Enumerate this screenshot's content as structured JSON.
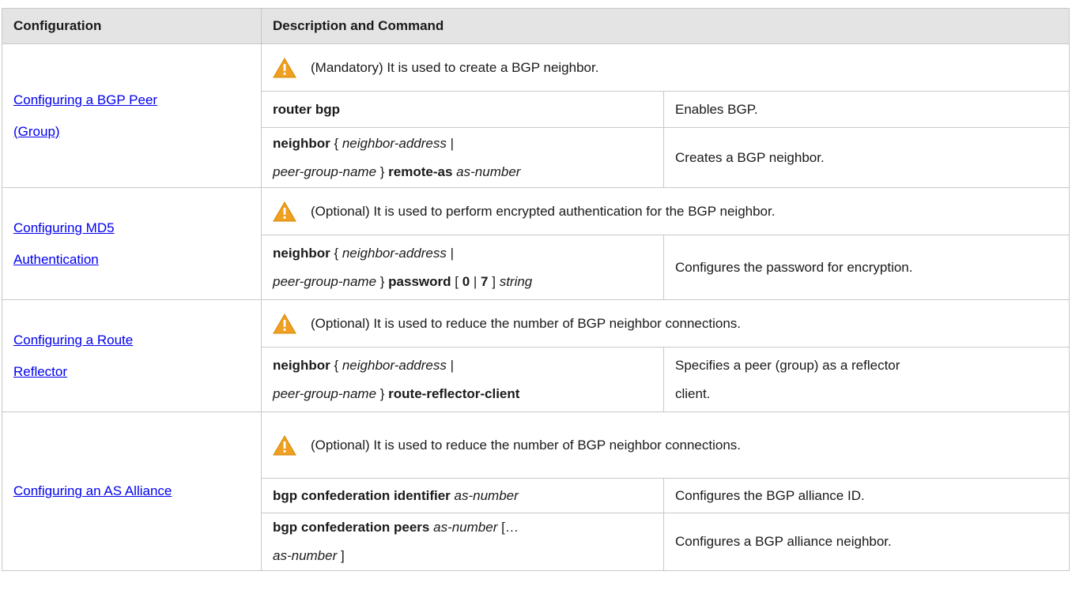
{
  "header": {
    "col1": "Configuration",
    "col2": "Description and Command"
  },
  "sections": [
    {
      "link_line1": "Configuring a BGP Peer ",
      "link_line2": "(Group)",
      "note": "(Mandatory) It is used to create a BGP neighbor.",
      "rows": [
        {
          "cmd": "<b>router bgp</b>",
          "desc": "Enables BGP."
        },
        {
          "cmd": "<b>neighbor</b> { <i>neighbor-address</i> |<br><i>peer-group-name</i> } <b>remote-as</b> <i>as-number</i>",
          "desc": "Creates a BGP neighbor."
        }
      ]
    },
    {
      "link_line1": "Configuring MD5 ",
      "link_line2": "Authentication",
      "note": "(Optional) It is used to perform encrypted authentication for the BGP neighbor.",
      "rows": [
        {
          "cmd": "<b>neighbor</b> { <i>neighbor-address</i> |<br><i>peer-group-name</i> } <b>password</b> [ <b>0</b> | <b>7</b> ] <i>string</i>",
          "desc": "Configures the password for encryption."
        }
      ]
    },
    {
      "link_line1": "Configuring a Route ",
      "link_line2": "Reflector",
      "note": "(Optional) It is used to reduce the number of BGP neighbor connections.",
      "rows": [
        {
          "cmd": "<b>neighbor</b> { <i>neighbor-address</i> |<br><i>peer-group-name</i> } <b>route-reflector-client</b>",
          "desc": "Specifies a peer (group) as a reflector<br>client."
        }
      ]
    },
    {
      "link_line1": "Configuring an AS Alliance",
      "link_line2": "",
      "note": "(Optional) It is used to reduce the number of BGP neighbor connections.",
      "rows": [
        {
          "cmd": "<b>bgp confederation identifier</b> <i>as-number</i>",
          "desc": "Configures the BGP alliance ID."
        },
        {
          "cmd": "<b>bgp confederation peers</b> <i>as-number</i> […<br><i>as-number</i> ]",
          "desc": "Configures a BGP alliance neighbor."
        }
      ]
    }
  ],
  "colors": {
    "header_bg": "#e4e4e4",
    "border": "#c8c8c8",
    "link": "#0000ee",
    "warn_icon": "#f0a020"
  },
  "icons": {
    "note_icon": "warning-triangle-icon"
  }
}
